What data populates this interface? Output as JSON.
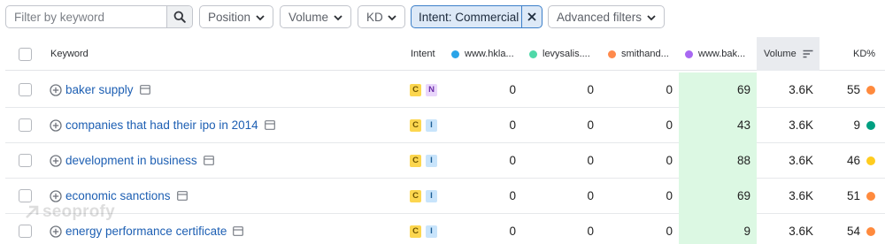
{
  "filters": {
    "search_placeholder": "Filter by keyword",
    "position_label": "Position",
    "volume_label": "Volume",
    "kd_label": "KD",
    "intent_chip_label": "Intent: Commercial",
    "advanced_label": "Advanced filters"
  },
  "table": {
    "headers": {
      "keyword": "Keyword",
      "intent": "Intent",
      "competitors": [
        {
          "label": "www.hkla...",
          "color": "#2aa4e8"
        },
        {
          "label": "levysalis....",
          "color": "#4fd8a8"
        },
        {
          "label": "smithand...",
          "color": "#ff8a4c"
        },
        {
          "label": "www.bak...",
          "color": "#a868f2"
        }
      ],
      "volume": "Volume",
      "kd": "KD%"
    },
    "highlight_color": "#dcf8e3",
    "rows": [
      {
        "keyword": "baker supply",
        "intents": [
          "C",
          "N"
        ],
        "values": [
          "0",
          "0",
          "0",
          "69"
        ],
        "volume": "3.6K",
        "kd": "55",
        "kd_color": "#ff8a3d"
      },
      {
        "keyword": "companies that had their ipo in 2014",
        "intents": [
          "C",
          "I"
        ],
        "values": [
          "0",
          "0",
          "0",
          "43"
        ],
        "volume": "3.6K",
        "kd": "9",
        "kd_color": "#009f81"
      },
      {
        "keyword": "development in business",
        "intents": [
          "C",
          "I"
        ],
        "values": [
          "0",
          "0",
          "0",
          "88"
        ],
        "volume": "3.6K",
        "kd": "46",
        "kd_color": "#ffcc1f"
      },
      {
        "keyword": "economic sanctions",
        "intents": [
          "C",
          "I"
        ],
        "values": [
          "0",
          "0",
          "0",
          "69"
        ],
        "volume": "3.6K",
        "kd": "51",
        "kd_color": "#ff8a3d"
      },
      {
        "keyword": "energy performance certificate",
        "intents": [
          "C",
          "I"
        ],
        "values": [
          "0",
          "0",
          "0",
          "9"
        ],
        "volume": "3.6K",
        "kd": "54",
        "kd_color": "#ff8a3d"
      }
    ]
  },
  "watermark": "seoprofy"
}
